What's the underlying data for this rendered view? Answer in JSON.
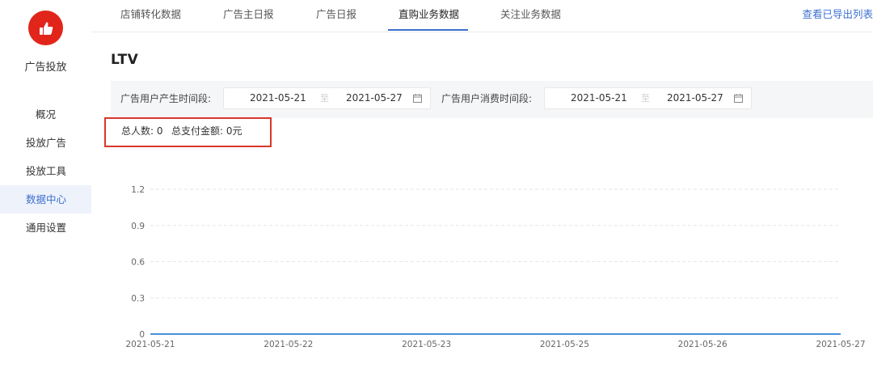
{
  "sidebar": {
    "logo_icon": "thumbs-up-icon",
    "brand_color": "#e1251b",
    "app_name": "广告投放",
    "items": [
      {
        "label": "概况"
      },
      {
        "label": "投放广告"
      },
      {
        "label": "投放工具"
      },
      {
        "label": "数据中心",
        "active": true
      },
      {
        "label": "通用设置"
      }
    ]
  },
  "tabs": {
    "items": [
      {
        "label": "店铺转化数据"
      },
      {
        "label": "广告主日报"
      },
      {
        "label": "广告日报"
      },
      {
        "label": "直购业务数据",
        "active": true
      },
      {
        "label": "关注业务数据"
      }
    ],
    "export_link": "查看已导出列表"
  },
  "page": {
    "title": "LTV"
  },
  "filters": {
    "user_time": {
      "label": "广告用户产生时间段:",
      "start": "2021-05-21",
      "sep": "至",
      "end": "2021-05-27"
    },
    "spend_time": {
      "label": "广告用户消费时间段:",
      "start": "2021-05-21",
      "sep": "至",
      "end": "2021-05-27"
    }
  },
  "summary": {
    "total_users": "总人数: 0",
    "total_paid": "总支付金额: 0元",
    "highlight_color": "#d9362b"
  },
  "chart_data": {
    "type": "line",
    "x": [
      "2021-05-21",
      "2021-05-22",
      "2021-05-23",
      "2021-05-25",
      "2021-05-26",
      "2021-05-27"
    ],
    "series": [
      {
        "values": [
          0,
          0,
          0,
          0,
          0,
          0
        ],
        "color": "#4a90d9"
      }
    ],
    "yticks": [
      "0",
      "0.3",
      "0.6",
      "0.9",
      "1.2"
    ],
    "ylim": [
      0,
      1.2
    ],
    "grid": true,
    "title": "",
    "xlabel": "",
    "ylabel": ""
  }
}
